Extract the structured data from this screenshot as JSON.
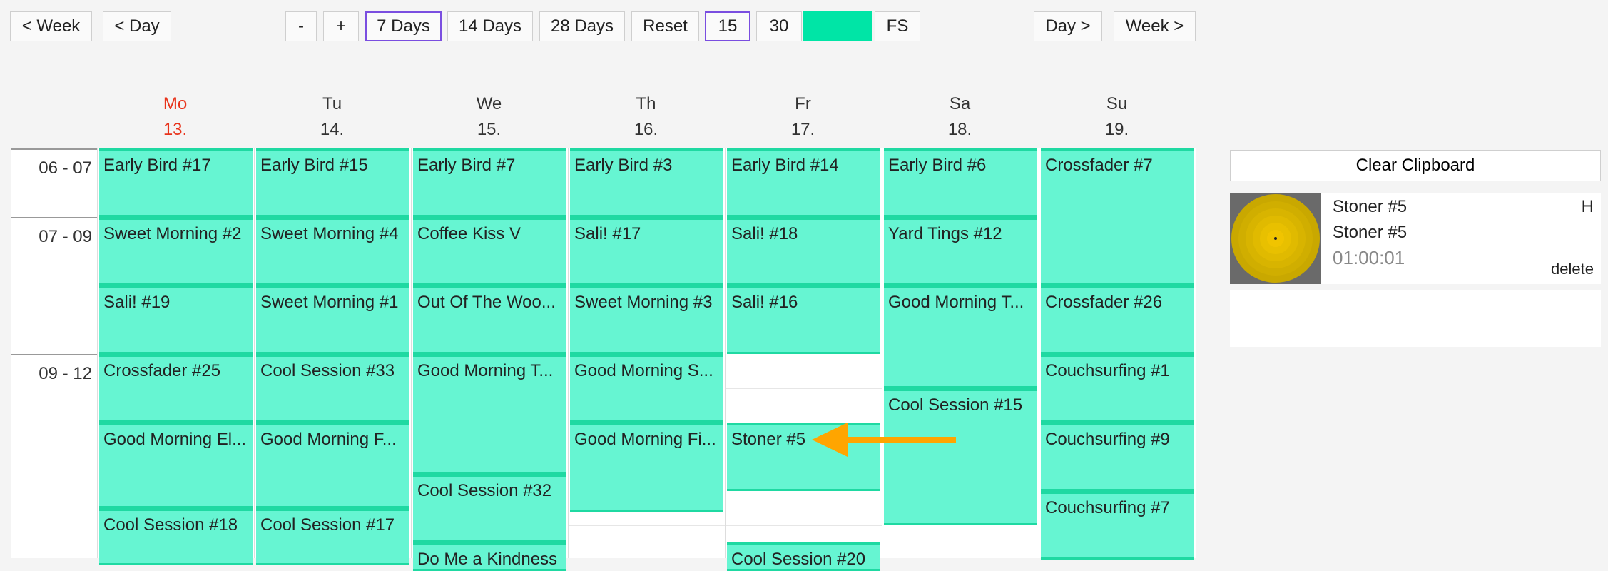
{
  "toolbar": {
    "week_back": "< Week",
    "day_back": "< Day",
    "zoom_out": "-",
    "zoom_in": "+",
    "days7": "7 Days",
    "days14": "14 Days",
    "days28": "28 Days",
    "reset": "Reset",
    "min15": "15",
    "min30": "30",
    "fs": "FS",
    "day_forward": "Day >",
    "week_forward": "Week >",
    "color_swatch": "#00e5a6",
    "active_border": "#7a4ee0"
  },
  "days": [
    {
      "name": "Mo",
      "date": "13."
    },
    {
      "name": "Tu",
      "date": "14."
    },
    {
      "name": "We",
      "date": "15."
    },
    {
      "name": "Th",
      "date": "16."
    },
    {
      "name": "Fr",
      "date": "17."
    },
    {
      "name": "Sa",
      "date": "18."
    },
    {
      "name": "Su",
      "date": "19."
    }
  ],
  "timeslots": [
    "06 - 07",
    "07 - 09",
    "09 - 12"
  ],
  "events": [
    [
      "Early Bird #17",
      "Sweet Morning #2",
      "Sali! #19",
      "Crossfader #25",
      "Good Morning El...",
      "Cool Session #18"
    ],
    [
      "Early Bird #15",
      "Sweet Morning #4",
      "Sweet Morning #1",
      "Cool Session #33",
      "Good Morning F...",
      "Cool Session #17"
    ],
    [
      "Early Bird #7",
      "Coffee Kiss V",
      "Out Of The Woo...",
      "Good Morning T...",
      "Cool Session #32",
      "Do Me a Kindness"
    ],
    [
      "Early Bird #3",
      "Sali! #17",
      "Sweet Morning #3",
      "Good Morning S...",
      "Good Morning Fi..."
    ],
    [
      "Early Bird #14",
      "Sali! #18",
      "Sali! #16",
      "Stoner #5",
      "Cool Session #20"
    ],
    [
      "Early Bird #6",
      "Yard Tings #12",
      "Good Morning T...",
      "Cool Session #15"
    ],
    [
      "Crossfader #7",
      "Crossfader #26",
      "Couchsurfing #1",
      "Couchsurfing #9",
      "Couchsurfing #7"
    ]
  ],
  "clipboard": {
    "clear_label": "Clear Clipboard",
    "item": {
      "title": "Stoner #5",
      "subtitle": "Stoner #5",
      "duration": "01:00:01",
      "badge": "H",
      "delete_label": "delete"
    }
  },
  "colors": {
    "event_fill": "#66f5d2",
    "event_border": "#1fd9a2",
    "today": "#e8321a",
    "arrow": "#ffa500"
  }
}
